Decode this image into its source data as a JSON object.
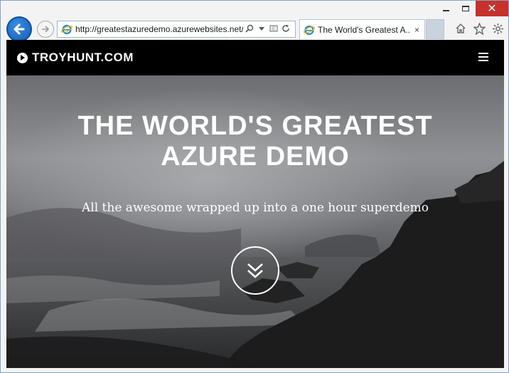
{
  "browser": {
    "url": "http://greatestazuredemo.azurewebsites.net/",
    "tab_title": "The World's Greatest A...",
    "tab_close": "×",
    "caption_close": "✕"
  },
  "site": {
    "logo_text": "TROYHUNT.COM",
    "hero_title_line1": "THE WORLD'S GREATEST",
    "hero_title_line2": "AZURE DEMO",
    "hero_subtitle": "All the awesome wrapped up into a one hour superdemo"
  },
  "colors": {
    "close_button": "#c7312b",
    "back_button": "#1d6fd0",
    "site_header": "#000000"
  }
}
